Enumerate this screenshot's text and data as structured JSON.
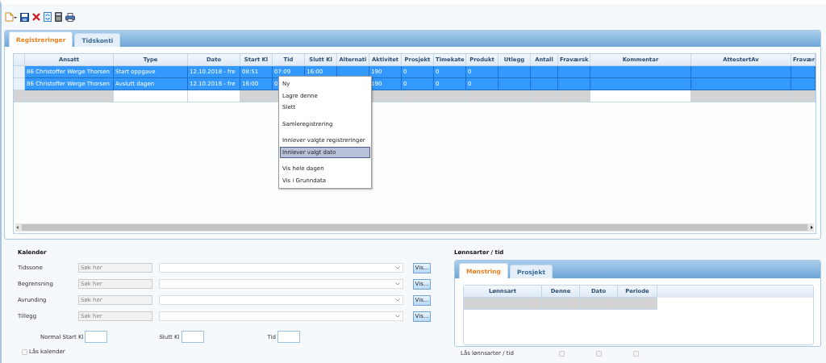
{
  "toolbar": {
    "buttons": [
      {
        "kind": "new"
      },
      {
        "kind": "save"
      },
      {
        "kind": "delete"
      },
      {
        "kind": "refresh"
      },
      {
        "kind": "calculator"
      },
      {
        "kind": "print"
      }
    ]
  },
  "main_tabs": [
    {
      "label": "Registreringer",
      "selected": true
    },
    {
      "label": "Tidskonti",
      "selected": false
    }
  ],
  "grid": {
    "columns": [
      "Ansatt",
      "Type",
      "Dato",
      "Start Kl",
      "Tid",
      "Slutt Kl",
      "Alternati",
      "Aktivitet",
      "Prosjekt",
      "Timekate",
      "Produkt",
      "Utlegg",
      "Antall",
      "Fraværsk",
      "Kommentar",
      "AttestertAv",
      "Fravær"
    ],
    "rows": [
      {
        "kind": "data",
        "selected": true,
        "cells": [
          "86 Christoffer Werge Thorsen",
          "Start oppgave",
          "12.10.2018 - fre",
          "08:51",
          "07:09",
          "16:00",
          {},
          "190",
          "0",
          "0",
          "0"
        ]
      },
      {
        "kind": "data",
        "selected": true,
        "cells": [
          "86 Christoffer Werge Thorsen",
          "Avslutt dagen",
          "12.10.2018 - fre",
          "16:00",
          "0",
          null,
          null,
          "190",
          "0",
          "0",
          "0"
        ]
      },
      {
        "kind": "new",
        "selected": false,
        "cells": [
          {
            "editable": false
          },
          {
            "editable": true
          },
          {
            "editable": true
          },
          {
            "editable": false
          },
          {
            "editable": false
          },
          null,
          null,
          {
            "editable": false
          },
          {
            "editable": false
          },
          {
            "editable": false
          },
          {
            "editable": false
          },
          {
            "editable": false
          },
          {
            "editable": false
          },
          {
            "editable": false
          },
          {
            "editable": true
          },
          {
            "editable": false
          },
          {
            "editable": false
          }
        ]
      }
    ]
  },
  "context_menu": {
    "groups": [
      [
        {
          "label": "Ny",
          "selected": false
        },
        {
          "label": "Lagre denne",
          "selected": false
        },
        {
          "label": "Slett",
          "selected": false
        }
      ],
      [
        {
          "label": "Samleregistrering",
          "selected": false
        }
      ],
      [
        {
          "label": "Innlever valgte registreringer",
          "selected": false
        },
        {
          "label": "Innlever valgt dato",
          "selected": true
        }
      ],
      [
        {
          "label": "Vis hele dagen",
          "selected": false
        },
        {
          "label": "Vis i Grunndata",
          "selected": false
        }
      ]
    ]
  },
  "kalender": {
    "title": "Kalender",
    "rows": [
      {
        "label": "Tidssone",
        "placeholder": "Søk her",
        "button": "Vis..."
      },
      {
        "label": "Begrensning",
        "placeholder": "Søk her",
        "button": "Vis..."
      },
      {
        "label": "Avrunding",
        "placeholder": "Søk her",
        "button": "Vis..."
      },
      {
        "label": "Tillegg",
        "placeholder": "Søk her",
        "button": "Vis..."
      }
    ],
    "times": [
      {
        "label": "Normal Start Kl"
      },
      {
        "label": "Slutt Kl"
      },
      {
        "label": "Tid"
      }
    ],
    "lock": {
      "label": "Lås kalender",
      "checked": false
    }
  },
  "lonnsarter": {
    "title": "Lønnsarter / tid",
    "tabs": [
      {
        "label": "Mønstring",
        "selected": true
      },
      {
        "label": "Prosjekt",
        "selected": false
      }
    ],
    "columns": [
      "Lønnsart",
      "Denne",
      "Dato",
      "Periode"
    ],
    "lock": {
      "label": "Lås lønnsarter / tid",
      "checkboxes": [
        {
          "checked": false
        },
        {
          "checked": false
        },
        {
          "checked": false
        }
      ]
    }
  }
}
